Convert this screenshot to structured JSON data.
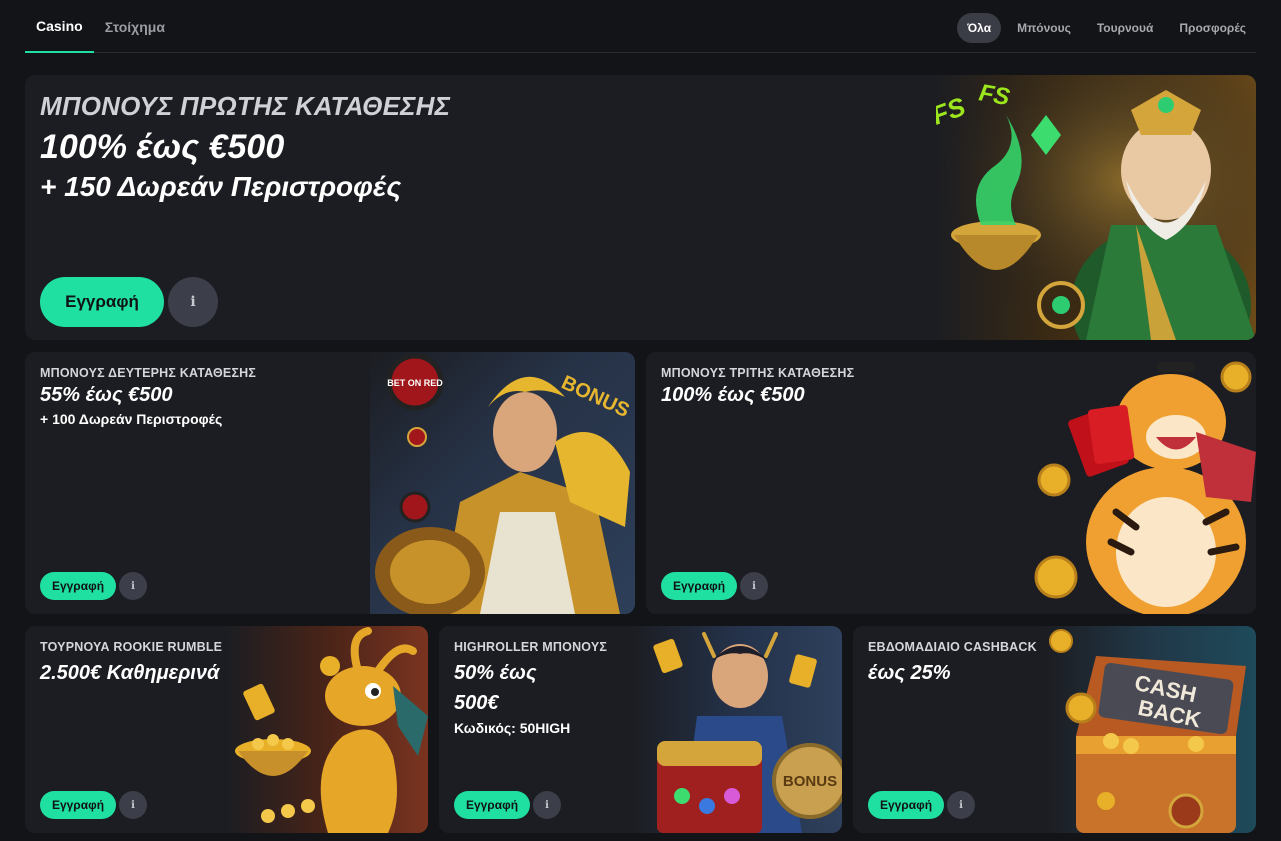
{
  "nav": {
    "tabs": [
      {
        "label": "Casino",
        "active": true
      },
      {
        "label": "Στοίχημα",
        "active": false
      }
    ],
    "filters": [
      {
        "label": "Όλα",
        "active": true
      },
      {
        "label": "Μπόνους",
        "active": false
      },
      {
        "label": "Τουρνουά",
        "active": false
      },
      {
        "label": "Προσφορές",
        "active": false
      }
    ]
  },
  "promos": {
    "hero": {
      "eyebrow": "ΜΠΟΝΟΥΣ ΠΡΩΤΗΣ ΚΑΤΑΘΕΣΗΣ",
      "headline": "100% έως €500",
      "sub": "+ 150 Δωρεάν Περιστροφές",
      "badges": [
        "FS",
        "FS"
      ],
      "cta": "Εγγραφή",
      "info_icon": "info-icon"
    },
    "second": {
      "eyebrow": "ΜΠΟΝΟΥΣ ΔΕΥΤΕΡΗΣ ΚΑΤΑΘΕΣΗΣ",
      "headline": "55% έως €500",
      "sub": "+ 100 Δωρεάν Περιστροφές",
      "chip_text": "BET ON RED",
      "bonus_text": "BONUS",
      "cta": "Εγγραφή"
    },
    "third": {
      "eyebrow": "ΜΠΟΝΟΥΣ ΤΡΙΤΗΣ ΚΑΤΑΘΕΣΗΣ",
      "headline": "100% έως €500",
      "cta": "Εγγραφή"
    },
    "tournament": {
      "eyebrow": "ΤΟΥΡΝΟΥΑ ROOKIE RUMBLE",
      "headline": "2.500€ Καθημερινά",
      "cta": "Εγγραφή"
    },
    "highroller": {
      "eyebrow": "HIGHROLLER ΜΠΟΝΟΥΣ",
      "headline_1": "50% έως",
      "headline_2": "500€",
      "sub": "Κωδικός: 50HIGH",
      "bonus_text": "BONUS",
      "cta": "Εγγραφή"
    },
    "cashback": {
      "eyebrow": "ΕΒΔΟΜΑΔΙΑΙΟ CASHBACK",
      "headline": "έως 25%",
      "chest_text_1": "CASH",
      "chest_text_2": "BACK",
      "cta": "Εγγραφή"
    }
  },
  "colors": {
    "accent": "#1fe0a0",
    "page_bg": "#131417",
    "card_bg": "#1c1d22"
  }
}
